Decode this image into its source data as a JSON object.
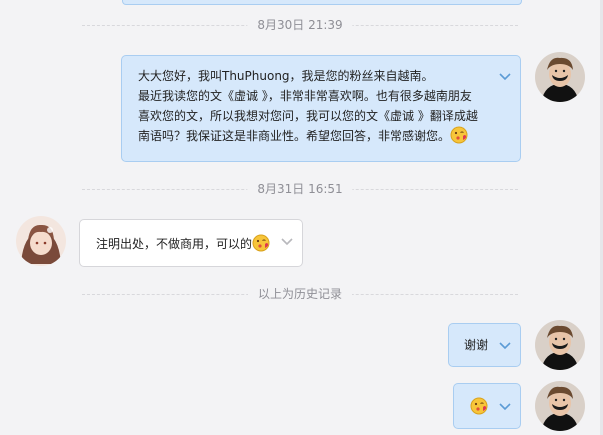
{
  "timestamps": {
    "first": "8月30日 21:39",
    "second": "8月31日 16:51"
  },
  "history_label": "以上为历史记录",
  "messages": {
    "me_long": {
      "line1": "大大您好，我叫ThuPhuong，我是您的粉丝来自越南。",
      "line2": "最近我读您的文《虚诚 》，非常非常喜欢啊。也有很多越南朋友",
      "line3": "喜欢您的文，所以我想对您问，我可以您的文《虚诚 》翻译成越",
      "line4": "南语吗？我保证这是非商业性。希望您回答，非常感谢您。"
    },
    "them_reply": "注明出处，不做商用，可以的",
    "me_thanks": "谢谢"
  },
  "icons": {
    "bubble_menu": "chevron-down-icon",
    "emoji": "kissing-emoji-icon"
  },
  "colors": {
    "my_bubble": "#d6e8fb",
    "my_bubble_border": "#a9cdf1",
    "their_bubble": "#ffffff",
    "background": "#f3f3f5",
    "chevron": "#5b9bd5"
  }
}
